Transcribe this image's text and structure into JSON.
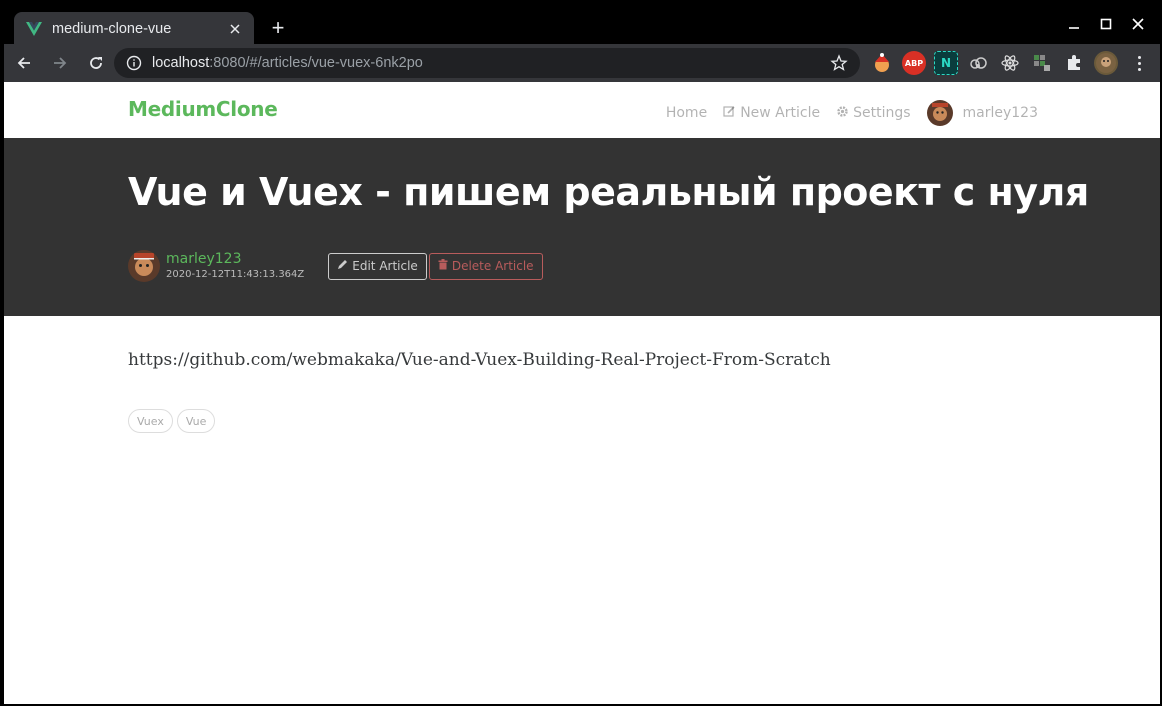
{
  "browser": {
    "tab_title": "medium-clone-vue",
    "new_tab_label": "+",
    "url_host": "localhost",
    "url_rest": ":8080/#/articles/vue-vuex-6nk2po",
    "extensions": [
      "extension-santa-icon",
      "abp-icon",
      "n-icon",
      "cloud-icon",
      "react-icon",
      "grid-icon",
      "puzzle-icon",
      "profile-icon"
    ],
    "abp_label": "ABP",
    "n_label": "N"
  },
  "navbar": {
    "brand": "MediumClone",
    "home": "Home",
    "new_article": "New Article",
    "settings": "Settings",
    "username": "marley123"
  },
  "article": {
    "title": "Vue и Vuex - пишем реальный проект с нуля",
    "author": "marley123",
    "date": "2020-12-12T11:43:13.364Z",
    "edit_label": "Edit Article",
    "delete_label": "Delete Article",
    "body": "https://github.com/webmakaka/Vue-and-Vuex-Building-Real-Project-From-Scratch",
    "tags": [
      "Vuex",
      "Vue"
    ]
  },
  "colors": {
    "accent": "#5cb85c",
    "banner": "#333333",
    "danger": "#b85c5c"
  }
}
